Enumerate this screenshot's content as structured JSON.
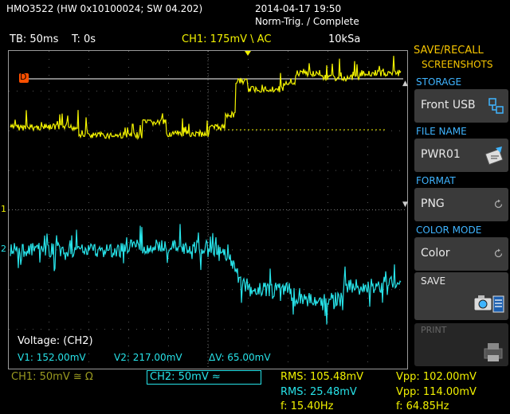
{
  "header": {
    "device": "HMO3522 (HW 0x10100024; SW 04.202)",
    "datetime": "2014-04-17 19:50",
    "trigger_state": "Norm-Trig. / Complete"
  },
  "status_bar": {
    "timebase": "TB: 50ms",
    "trig_time": "T: 0s",
    "ch1_trigger": "CH1: 175mV \\ AC",
    "sample_rate": "10kSa"
  },
  "menu": {
    "title": "SAVE/RECALL",
    "subtitle": "SCREENSHOTS",
    "storage": {
      "heading": "STORAGE",
      "value": "Front USB",
      "icon": "usb-storage-icon"
    },
    "file_name": {
      "heading": "FILE NAME",
      "value": "PWR01",
      "icon": "edit-name-icon"
    },
    "format": {
      "heading": "FORMAT",
      "value": "PNG",
      "icon": "cycle-icon"
    },
    "color_mode": {
      "heading": "COLOR MODE",
      "value": "Color",
      "icon": "cycle-icon"
    },
    "save": {
      "label": "SAVE",
      "icon": "camera-icon"
    },
    "print": {
      "label": "PRINT",
      "icon": "printer-icon"
    }
  },
  "cursor_readout": {
    "title": "Voltage: (CH2)",
    "v1": "V1: 152.00mV",
    "v2": "V2: 217.00mV",
    "dv": "ΔV: 65.00mV"
  },
  "channels": {
    "ch1": {
      "label": "CH1: 50mV ≅ Ω",
      "color": "#f2f200"
    },
    "ch2": {
      "label": "CH2: 50mV ≈",
      "color": "#27e2e8"
    }
  },
  "measurements": {
    "rms_ch1": "RMS: 105.48mV",
    "rms_ch2": "RMS: 25.48mV",
    "freq_ch2": "f: 15.40Hz",
    "vpp_ch1": "Vpp: 102.00mV",
    "vpp_ch2": "Vpp: 114.00mV",
    "freq_ch1": "f: 64.85Hz"
  },
  "markers": {
    "trigger_marker": "D",
    "ch1_marker": "1",
    "ch2_marker": "2"
  },
  "colors": {
    "ch1": "#f2f200",
    "ch2": "#27e2e8",
    "menu_heading": "#3fb4ff",
    "menu_title": "#f5c400",
    "grid": "#555555",
    "trigger_marker": "#ff5000"
  }
}
